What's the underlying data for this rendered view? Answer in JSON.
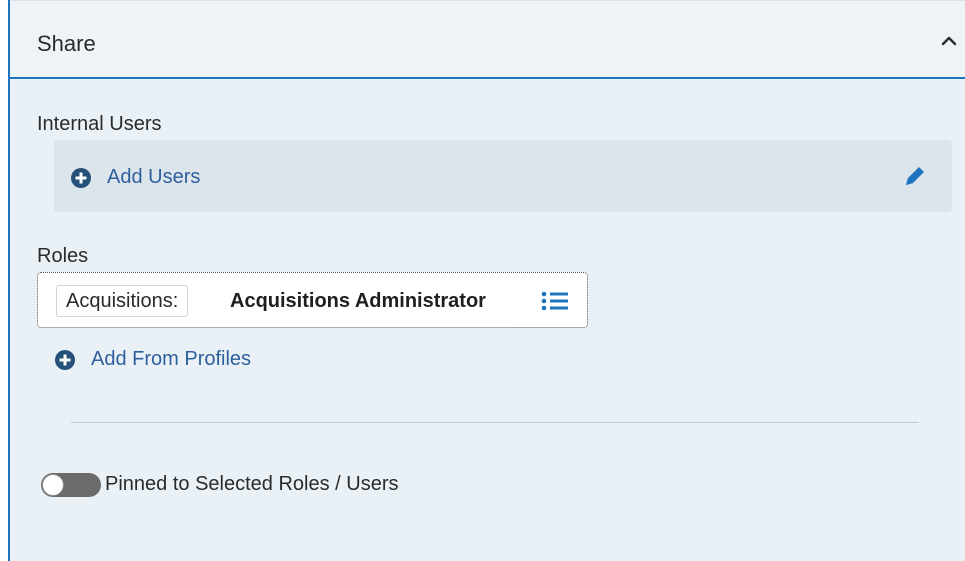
{
  "header": {
    "title": "Share",
    "collapse_icon": "chevron-up-icon"
  },
  "internal_users": {
    "label": "Internal Users",
    "add_label": "Add Users",
    "add_icon": "plus-circle-icon",
    "edit_icon": "pencil-icon"
  },
  "roles": {
    "label": "Roles",
    "items": [
      {
        "prefix": "Acquisitions:",
        "name": "Acquisitions Administrator",
        "icon": "list-icon"
      }
    ],
    "add_label": "Add From Profiles",
    "add_icon": "plus-circle-icon"
  },
  "pinned": {
    "label": "Pinned to Selected Roles / Users",
    "enabled": false
  },
  "colors": {
    "accent": "#1f74c0",
    "link": "#2d5f9e",
    "icon_dark": "#24507a",
    "panel_bg": "#e9f1f6",
    "box_bg": "#dde5ec"
  }
}
